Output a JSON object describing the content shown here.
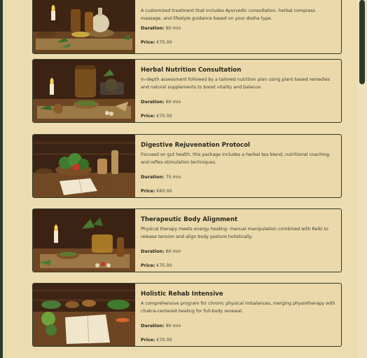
{
  "services": [
    {
      "title": "",
      "description": "A customized treatment that includes Ayurvedic consultation, herbal compress massage, and lifestyle guidance based on your dosha type.",
      "duration_label": "Duration:",
      "duration": "90 min",
      "price_label": "Price:",
      "price": "€70.00"
    },
    {
      "title": "Herbal Nutrition Consultation",
      "description": "In-depth assessment followed by a tailored nutrition plan using plant-based remedies and natural supplements to boost vitality and balance.",
      "duration_label": "Duration:",
      "duration": "60 min",
      "price_label": "Price:",
      "price": "€70.00"
    },
    {
      "title": "Digestive Rejuvenation Protocol",
      "description": "Focused on gut health, this package includes a herbal tea blend, nutritional coaching, and reflex-stimulation techniques.",
      "duration_label": "Duration:",
      "duration": "75 min",
      "price_label": "Price:",
      "price": "€60.00"
    },
    {
      "title": "Therapeutic Body Alignment",
      "description": "Physical therapy meets energy healing: manual manipulation combined with Reiki to release tension and align body posture holistically.",
      "duration_label": "Duration:",
      "duration": "60 min",
      "price_label": "Price:",
      "price": "€75.00"
    },
    {
      "title": "Holistic Rehab Intensive",
      "description": "A comprehensive program for chronic physical imbalances, merging physiotherapy with chakra-centered healing for full-body renewal.",
      "duration_label": "Duration:",
      "duration": "90 min",
      "price_label": "Price:",
      "price": "€70.00"
    }
  ]
}
